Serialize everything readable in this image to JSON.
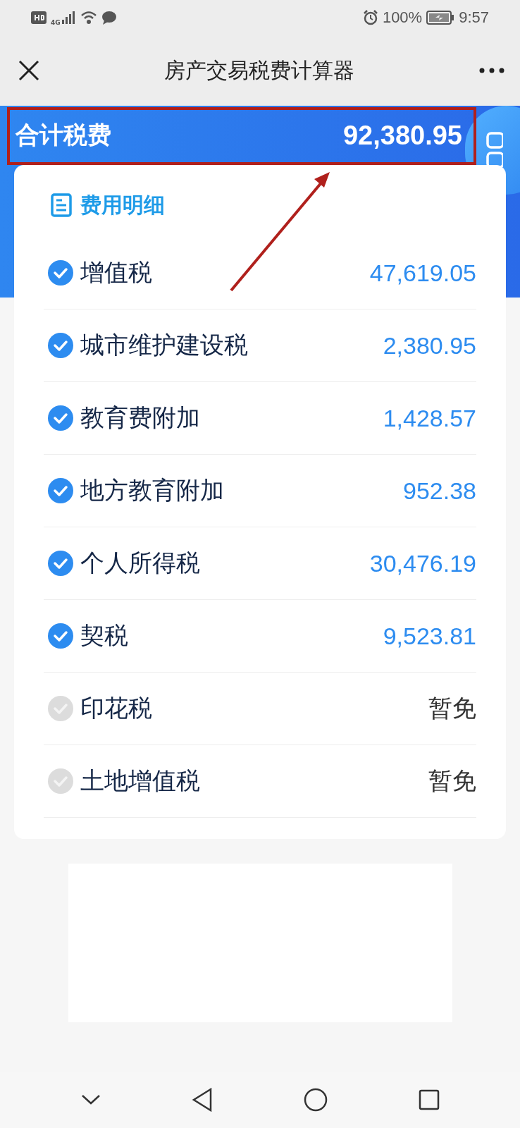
{
  "status_bar": {
    "network": "4G",
    "battery": "100%",
    "time": "9:57"
  },
  "nav": {
    "title": "房产交易税费计算器"
  },
  "total": {
    "label": "合计税费",
    "value": "92,380.95"
  },
  "detail": {
    "title": "费用明细",
    "items": [
      {
        "name": "增值税",
        "value": "47,619.05",
        "checked": true
      },
      {
        "name": "城市维护建设税",
        "value": "2,380.95",
        "checked": true
      },
      {
        "name": "教育费附加",
        "value": "1,428.57",
        "checked": true
      },
      {
        "name": "地方教育附加",
        "value": "952.38",
        "checked": true
      },
      {
        "name": "个人所得税",
        "value": "30,476.19",
        "checked": true
      },
      {
        "name": "契税",
        "value": "9,523.81",
        "checked": true
      },
      {
        "name": "印花税",
        "value": "暂免",
        "checked": false
      },
      {
        "name": "土地增值税",
        "value": "暂免",
        "checked": false
      }
    ]
  }
}
